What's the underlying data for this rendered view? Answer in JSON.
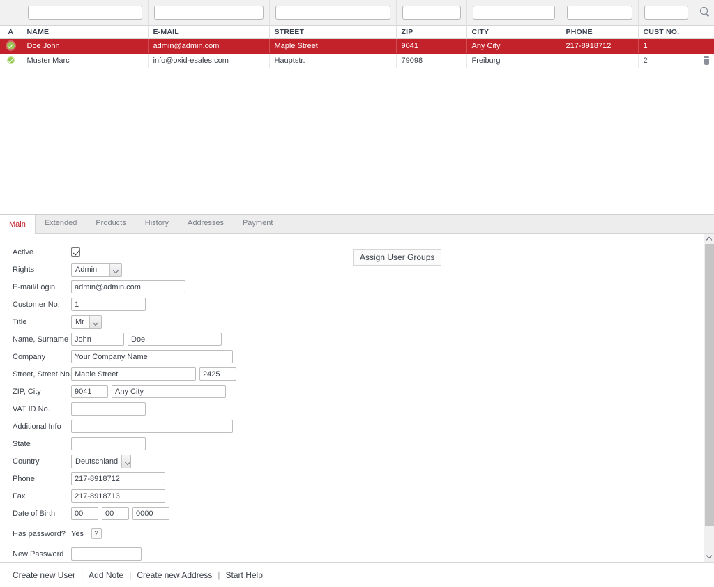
{
  "grid": {
    "columns": [
      {
        "key": "active",
        "label": "A"
      },
      {
        "key": "name",
        "label": "NAME"
      },
      {
        "key": "email",
        "label": "E-MAIL"
      },
      {
        "key": "street",
        "label": "STREET"
      },
      {
        "key": "zip",
        "label": "ZIP"
      },
      {
        "key": "city",
        "label": "CITY"
      },
      {
        "key": "phone",
        "label": "PHONE"
      },
      {
        "key": "custno",
        "label": "CUST NO."
      },
      {
        "key": "actions",
        "label": ""
      }
    ],
    "filters": {
      "name": "",
      "email": "",
      "street": "",
      "zip": "",
      "city": "",
      "phone": "",
      "custno": "",
      "placeholder": ""
    },
    "search_icon": "search-icon",
    "rows": [
      {
        "status_icon": "active-check-icon",
        "name": "Doe John",
        "email": "admin@admin.com",
        "street": "Maple Street",
        "zip": "9041",
        "city": "Any City",
        "phone": "217-8918712",
        "custno": "1",
        "selected": true,
        "delete_icon": ""
      },
      {
        "status_icon": "active-check-icon",
        "name": "Muster Marc",
        "email": "info@oxid-esales.com",
        "street": "Hauptstr.",
        "zip": "79098",
        "city": "Freiburg",
        "phone": "",
        "custno": "2",
        "selected": false,
        "delete_icon": "trash-icon"
      }
    ],
    "selected_row_color": "#c3222b",
    "status_color": "#96c952"
  },
  "tabs": [
    {
      "label": "Main",
      "active": true
    },
    {
      "label": "Extended",
      "active": false
    },
    {
      "label": "Products",
      "active": false
    },
    {
      "label": "History",
      "active": false
    },
    {
      "label": "Addresses",
      "active": false
    },
    {
      "label": "Payment",
      "active": false
    }
  ],
  "tab_active_color": "#c3222b",
  "form": {
    "active": {
      "label": "Active",
      "checked": true
    },
    "rights": {
      "label": "Rights",
      "value": "Admin"
    },
    "email_login": {
      "label": "E-mail/Login",
      "value": "admin@admin.com"
    },
    "customer_no": {
      "label": "Customer No.",
      "value": "1"
    },
    "title": {
      "label": "Title",
      "value": "Mr"
    },
    "name_surname": {
      "label": "Name, Surname",
      "first": "John",
      "last": "Doe"
    },
    "company": {
      "label": "Company",
      "value": "Your Company Name"
    },
    "street": {
      "label": "Street, Street No.",
      "street": "Maple Street",
      "number": "2425"
    },
    "zip_city": {
      "label": "ZIP, City",
      "zip": "9041",
      "city": "Any City"
    },
    "vat_id": {
      "label": "VAT ID No.",
      "value": ""
    },
    "additional_info": {
      "label": "Additional Info",
      "value": ""
    },
    "state": {
      "label": "State",
      "value": ""
    },
    "country": {
      "label": "Country",
      "value": "Deutschland"
    },
    "phone": {
      "label": "Phone",
      "value": "217-8918712"
    },
    "fax": {
      "label": "Fax",
      "value": "217-8918713"
    },
    "dob": {
      "label": "Date of Birth",
      "day": "00",
      "month": "00",
      "year": "0000"
    },
    "has_password": {
      "label": "Has password?",
      "value": "Yes",
      "help": "?"
    },
    "new_password": {
      "label": "New Password",
      "value": ""
    }
  },
  "groups_panel": {
    "title": "Assign User Groups"
  },
  "scrollbar": {
    "up_icon": "chevron-up-icon",
    "down_icon": "chevron-down-icon"
  },
  "footer": {
    "links": [
      "Create new User",
      "Add Note",
      "Create new Address",
      "Start Help"
    ],
    "separator": "|"
  }
}
